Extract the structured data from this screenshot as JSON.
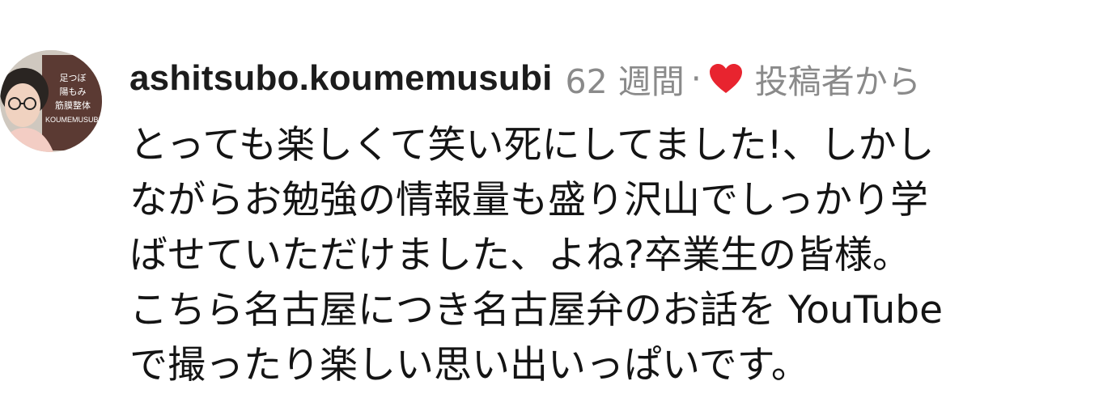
{
  "comment": {
    "username": "ashitsubo.koumemusubi",
    "time": "62 週間",
    "separator": "·",
    "liked_by_author_label": "投稿者から",
    "heart_color": "#e8242f",
    "avatar_icon": "profile-photo-icon",
    "avatar_sign_lines": [
      "足つぼ",
      "陽もみ",
      "筋膜整体",
      "KOUMEMUSUBI"
    ],
    "text_lines": [
      "とっても楽しくて笑い死にしてました!、しかし",
      "ながらお勉強の情報量も盛り沢山でしっかり学",
      "ばせていただけました、よね?卒業生の皆様。",
      "こちら名古屋につき名古屋弁のお話を YouTube",
      "で撮ったり楽しい思い出いっぱいです。"
    ]
  }
}
